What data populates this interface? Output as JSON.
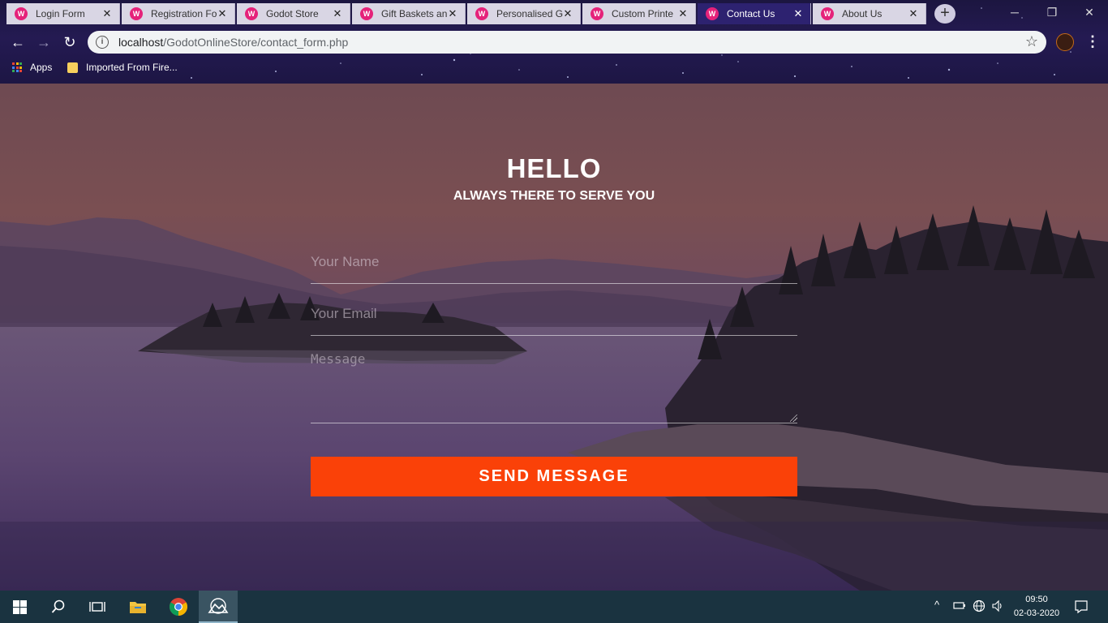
{
  "browser": {
    "tabs": [
      {
        "label": "Login Form",
        "active": false
      },
      {
        "label": "Registration Fo",
        "active": false
      },
      {
        "label": "Godot Store",
        "active": false
      },
      {
        "label": "Gift Baskets an",
        "active": false
      },
      {
        "label": "Personalised G",
        "active": false
      },
      {
        "label": "Custom Printe",
        "active": false
      },
      {
        "label": "Contact Us",
        "active": true
      },
      {
        "label": "About Us",
        "active": false
      }
    ],
    "url_host": "localhost",
    "url_path": "/GodotOnlineStore/contact_form.php",
    "bookmarks": [
      {
        "label": "Apps",
        "icon": "apps-grid-icon"
      },
      {
        "label": "Imported From Fire...",
        "icon": "folder-icon"
      }
    ],
    "colors": {
      "active_tab": "#2d2270",
      "favicon": "#e5227a"
    }
  },
  "page": {
    "heading": "HELLO",
    "subheading": "ALWAYS THERE TO SERVE YOU",
    "form": {
      "name_placeholder": "Your Name",
      "email_placeholder": "Your Email",
      "message_placeholder": "Message",
      "submit_label": "SEND MESSAGE"
    },
    "colors": {
      "button": "#fa4108",
      "text": "#ffffff"
    }
  },
  "taskbar": {
    "time": "09:50",
    "date": "02-03-2020",
    "apps": [
      "windows-start-icon",
      "search-icon",
      "task-view-icon",
      "file-explorer-icon",
      "chrome-icon",
      "photos-app-icon"
    ]
  }
}
